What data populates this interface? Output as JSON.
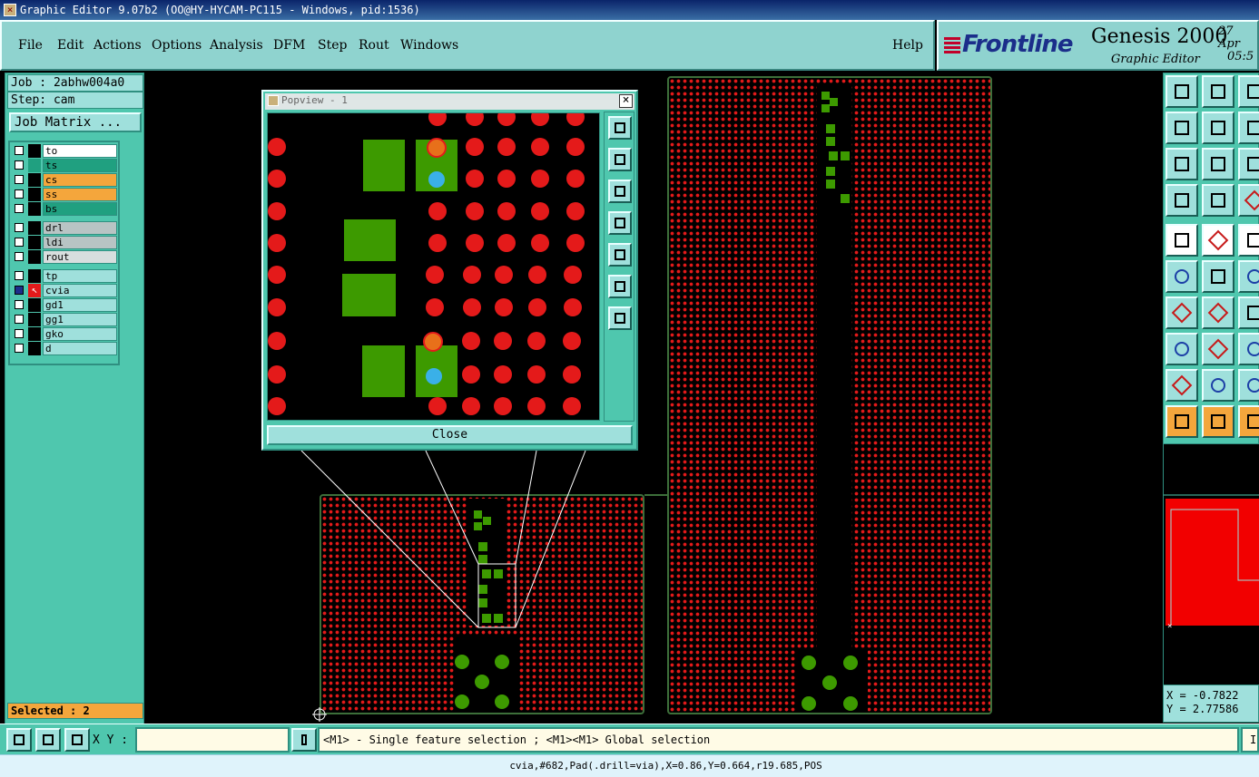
{
  "window": {
    "title": "Graphic Editor 9.07b2 (OO@HY-HYCAM-PC115 - Windows, pid:1536)"
  },
  "menu": {
    "items": [
      "File",
      "Edit",
      "Actions",
      "Options",
      "Analysis",
      "DFM",
      "Step",
      "Rout",
      "Windows"
    ],
    "help": "Help"
  },
  "brand": {
    "logo": "Frontline",
    "product": "Genesis 2000",
    "subtitle": "Graphic Editor",
    "date_line1": "27 Apr",
    "date_line2": "05:5"
  },
  "job": {
    "job_line": "Job : 2abhw004a0",
    "step_line": "Step: cam",
    "matrix_button": "Job Matrix ..."
  },
  "layers": [
    {
      "name": "to",
      "color": "#ffffff"
    },
    {
      "name": "ts",
      "color": "#20a080"
    },
    {
      "name": "cs",
      "color": "#f4a63c"
    },
    {
      "name": "ss",
      "color": "#f4a63c"
    },
    {
      "name": "bs",
      "color": "#20a080"
    },
    {
      "name": "drl",
      "color": "#b8c4c4"
    },
    {
      "name": "ldi",
      "color": "#b8c4c4"
    },
    {
      "name": "rout",
      "color": "#d8dede"
    },
    {
      "name": "tp",
      "color": "#9fe0dc"
    },
    {
      "name": "cvia",
      "color": "#9fe0dc"
    },
    {
      "name": "gd1",
      "color": "#9fe0dc"
    },
    {
      "name": "gg1",
      "color": "#9fe0dc"
    },
    {
      "name": "gko",
      "color": "#9fe0dc"
    },
    {
      "name": "d",
      "color": "#9fe0dc"
    }
  ],
  "selected_label": "Selected : 2",
  "popview": {
    "title": "Popview - 1",
    "close_button": "Close"
  },
  "coords": {
    "x": "X = -0.7822",
    "y": "Y = 2.77586"
  },
  "bottom": {
    "xy_label": "X Y :",
    "xy_value": "",
    "message": "<M1> - Single feature selection ; <M1><M1> Global selection",
    "message_right": "I"
  },
  "status": {
    "feature_info": "cvia,#682,Pad(.drill=via),X=0.86,Y=0.664,r19.685,POS"
  },
  "colors": {
    "panel": "#4fc7ae",
    "pad_red": "#e41a1a",
    "pad_green": "#3d9a00",
    "via_blue": "#3ab0e8",
    "via_orange": "#e8701a"
  }
}
